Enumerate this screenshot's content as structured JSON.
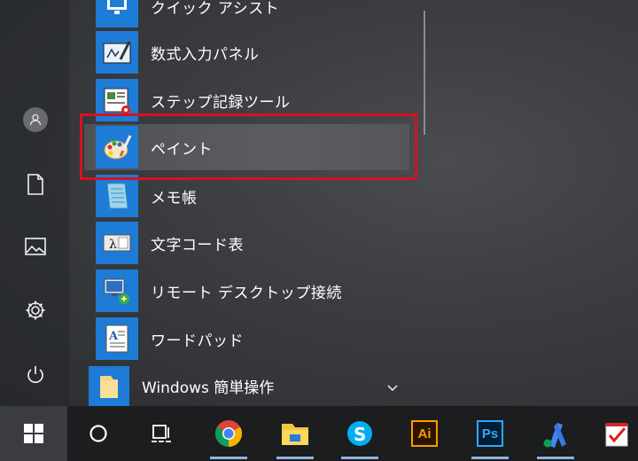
{
  "apps": [
    {
      "label": "クイック アシスト",
      "icon": "quick-assist-icon"
    },
    {
      "label": "数式入力パネル",
      "icon": "math-input-panel-icon"
    },
    {
      "label": "ステップ記録ツール",
      "icon": "steps-recorder-icon"
    },
    {
      "label": "ペイント",
      "icon": "paint-icon"
    },
    {
      "label": "メモ帳",
      "icon": "notepad-icon"
    },
    {
      "label": "文字コード表",
      "icon": "character-map-icon"
    },
    {
      "label": "リモート デスクトップ接続",
      "icon": "remote-desktop-icon"
    },
    {
      "label": "ワードパッド",
      "icon": "wordpad-icon"
    }
  ],
  "folder": {
    "label": "Windows 簡単操作",
    "icon": "folder-icon"
  },
  "taskbar_apps": [
    {
      "name": "chrome",
      "label": ""
    },
    {
      "name": "file-explorer",
      "label": ""
    },
    {
      "name": "skype",
      "label": ""
    },
    {
      "name": "illustrator",
      "label": "Ai"
    },
    {
      "name": "photoshop",
      "label": "Ps"
    },
    {
      "name": "adwords",
      "label": ""
    },
    {
      "name": "checkmark-app",
      "label": ""
    }
  ],
  "colors": {
    "accent": "#1e7bd6",
    "highlight": "#d3131f"
  }
}
